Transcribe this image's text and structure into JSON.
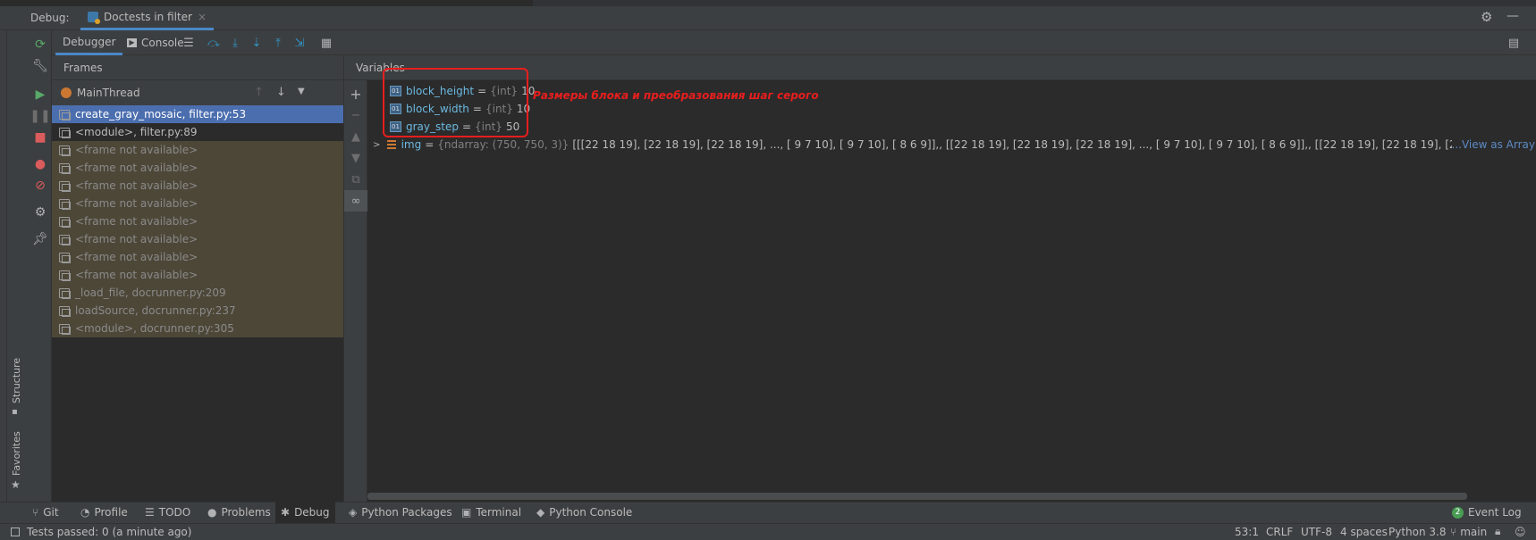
{
  "header": {
    "debug_label": "Debug:",
    "session_tab": "Doctests in filter"
  },
  "toolbar": {
    "debugger_tab": "Debugger",
    "console_tab": "Console"
  },
  "frames": {
    "title": "Frames",
    "thread": "MainThread",
    "items": [
      {
        "label": "create_gray_mosaic, filter.py:53",
        "state": "selected"
      },
      {
        "label": "<module>, filter.py:89",
        "state": "normal"
      },
      {
        "label": "<frame not available>",
        "state": "library"
      },
      {
        "label": "<frame not available>",
        "state": "library"
      },
      {
        "label": "<frame not available>",
        "state": "library"
      },
      {
        "label": "<frame not available>",
        "state": "library"
      },
      {
        "label": "<frame not available>",
        "state": "library"
      },
      {
        "label": "<frame not available>",
        "state": "library"
      },
      {
        "label": "<frame not available>",
        "state": "library"
      },
      {
        "label": "<frame not available>",
        "state": "library"
      },
      {
        "label": "_load_file, docrunner.py:209",
        "state": "library"
      },
      {
        "label": "loadSource, docrunner.py:237",
        "state": "library"
      },
      {
        "label": "<module>, docrunner.py:305",
        "state": "library"
      }
    ]
  },
  "variables": {
    "title": "Variables",
    "items": [
      {
        "name": "block_height",
        "type": "{int}",
        "value": "10"
      },
      {
        "name": "block_width",
        "type": "{int}",
        "value": "10"
      },
      {
        "name": "gray_step",
        "type": "{int}",
        "value": "50"
      }
    ],
    "img": {
      "name": "img",
      "type": "{ndarray: (750, 750, 3)}",
      "value": "[[[22 18 19],  [22 18 19],  [22 18 19],  ...,  [ 9  7 10],  [ 9  7 10],  [ 8  6  9]],, [[22 18 19],  [22 18 19],  [22 18 19],  ...,  [ 9  7 10],  [ 9  7 10],  [ 8  6  9]],, [[22 18 19],  [22 18 19],  [22 18 19],  ...,  [ 9  7 10],  [ 9  7 10]",
      "link": "...View as Array"
    }
  },
  "annotation": {
    "text": "Размеры блока и преобразования шаг серого",
    "color": "#e81e1e"
  },
  "side_labels": {
    "structure": "Structure",
    "favorites": "Favorites"
  },
  "bottom_tabs": {
    "git": "Git",
    "profile": "Profile",
    "todo": "TODO",
    "problems": "Problems",
    "debug": "Debug",
    "python_packages": "Python Packages",
    "terminal": "Terminal",
    "python_console": "Python Console",
    "event_log": "Event Log",
    "event_count": "2"
  },
  "status": {
    "message": "Tests passed: 0 (a minute ago)",
    "position": "53:1",
    "line_sep": "CRLF",
    "encoding": "UTF-8",
    "indent": "4 spaces",
    "interpreter": "Python 3.8",
    "branch": "main"
  }
}
